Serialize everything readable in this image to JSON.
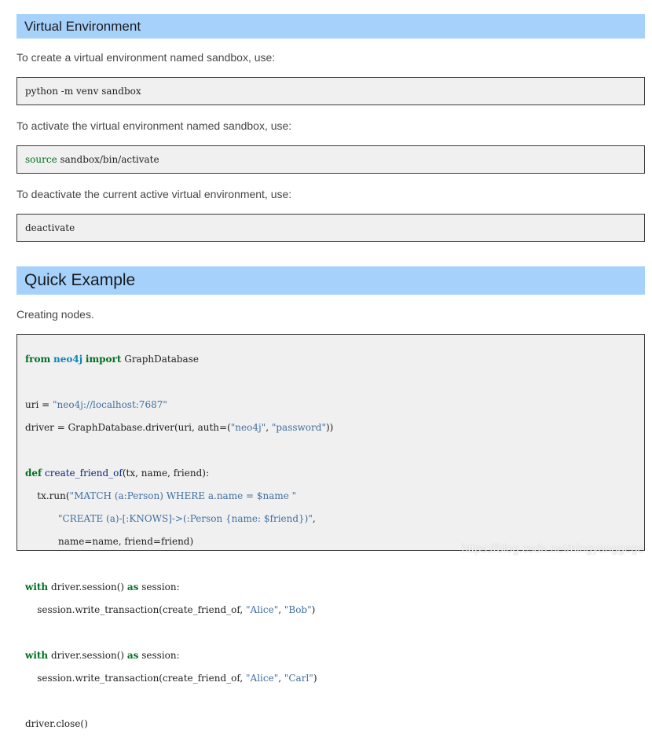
{
  "section1": {
    "title": "Virtual Environment",
    "para_create": "To create a virtual environment named sandbox, use:",
    "code_create": "python -m venv sandbox",
    "para_activate": "To activate the virtual environment named sandbox, use:",
    "code_activate_kw": "source",
    "code_activate_rest": " sandbox/bin/activate",
    "para_deactivate": "To deactivate the current active virtual environment, use:",
    "code_deactivate": "deactivate"
  },
  "section2": {
    "title": "Quick Example",
    "para": "Creating nodes.",
    "code": {
      "l1_from": "from",
      "l1_mod": "neo4j",
      "l1_import": "import",
      "l1_rest": " GraphDatabase",
      "l3_a": "uri = ",
      "l3_str": "\"neo4j://localhost:7687\"",
      "l4_a": "driver = GraphDatabase.driver(uri, auth=(",
      "l4_s1": "\"neo4j\"",
      "l4_b": ", ",
      "l4_s2": "\"password\"",
      "l4_c": "))",
      "l6_def": "def",
      "l6_fn": "create_friend_of",
      "l6_rest": "(tx, name, friend):",
      "l7_a": "    tx.run(",
      "l7_s": "\"MATCH (a:Person) WHERE a.name = $name \"",
      "l8_pad": "           ",
      "l8_s": "\"CREATE (a)-[:KNOWS]->(:Person {name: $friend})\"",
      "l8_end": ",",
      "l9": "           name=name, friend=friend)",
      "l11_with": "with",
      "l11_mid": " driver.session() ",
      "l11_as": "as",
      "l11_end": " session:",
      "l12_a": "    session.write_transaction(create_friend_of, ",
      "l12_s1": "\"Alice\"",
      "l12_b": ", ",
      "l12_s2": "\"Bob\"",
      "l12_c": ")",
      "l14_with": "with",
      "l14_mid": " driver.session() ",
      "l14_as": "as",
      "l14_end": " session:",
      "l15_a": "    session.write_transaction(create_friend_of, ",
      "l15_s1": "\"Alice\"",
      "l15_b": ", ",
      "l15_s2": "\"Carl\"",
      "l15_c": ")",
      "l17": "driver.close()"
    }
  },
  "watermark": "https://blog.csdn.net/ningyanggege"
}
